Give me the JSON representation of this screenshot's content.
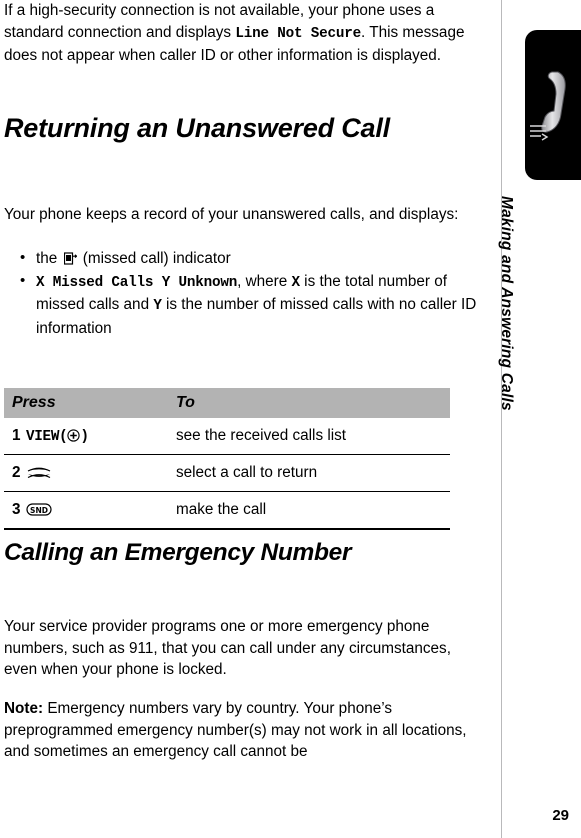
{
  "page": {
    "number": "29",
    "chapter": "Making and Answering Calls"
  },
  "intro": {
    "text_1": "If a high-security connection is not available, your phone uses a standard connection and displays ",
    "mono_1": "Line Not Secure",
    "text_2": ". This message does not appear when caller ID or other information is displayed."
  },
  "section_unanswered": {
    "heading": "Returning an Unanswered Call",
    "paragraph": "Your phone keeps a record of your unanswered calls, and displays:",
    "bullets": [
      {
        "text_before": "the ",
        "icon": "missed-call-icon",
        "text_after": " (missed call) indicator"
      },
      {
        "mono_1": "X Missed Calls Y Unknown",
        "text_1": ", where ",
        "mono_2": "X",
        "text_2": " is the total number of missed calls and ",
        "mono_3": "Y",
        "text_3": " is the number of missed calls with no caller ID information"
      }
    ],
    "table": {
      "headers": {
        "press": "Press",
        "to": "To"
      },
      "rows": [
        {
          "num": "1",
          "key_label": "VIEW",
          "key_icon": "softkey-plus-icon",
          "key_paren_open": "(",
          "key_paren_close": ")",
          "action": "see the received calls list"
        },
        {
          "num": "2",
          "key_icon": "nav-updown-icon",
          "action": "select a call to return"
        },
        {
          "num": "3",
          "key_icon": "send-key-icon",
          "action": "make the call"
        }
      ]
    }
  },
  "section_emergency": {
    "heading": "Calling an Emergency Number",
    "paragraph": "Your service provider programs one or more emergency phone numbers, such as 911, that you can call under any circumstances, even when your phone is locked.",
    "note_label": "Note:",
    "note_text": " Emergency numbers vary by country. Your phone’s preprogrammed emergency number(s) may not work in all locations, and sometimes an emergency call cannot be"
  },
  "colors": {
    "table_header_bg": "#b3b3b3",
    "rail_line": "#b9b9bb",
    "badge_bg": "#000000"
  }
}
